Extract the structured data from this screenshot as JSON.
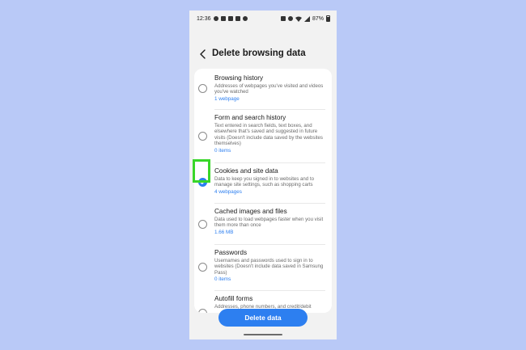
{
  "status_bar": {
    "time": "12:36",
    "battery": "87%",
    "icons_left": [
      "whatsapp-icon",
      "notification-icon",
      "gallery-icon",
      "grid-icon",
      "shazam-icon"
    ],
    "icons_right": [
      "vibrate-icon",
      "alarm-icon",
      "wifi-icon",
      "signal-icon",
      "battery-icon"
    ]
  },
  "header": {
    "title": "Delete browsing data"
  },
  "items": [
    {
      "title": "Browsing history",
      "description": "Addresses of webpages you've visited and videos you've watched",
      "count": "1 webpage",
      "checked": false
    },
    {
      "title": "Form and search history",
      "description": "Text entered in search fields, text boxes, and elsewhere that's saved and suggested in future visits (Doesn't include data saved by the websites themselves)",
      "count": "0 items",
      "checked": false
    },
    {
      "title": "Cookies and site data",
      "description": "Data to keep you signed in to websites and to manage site settings, such as shopping carts",
      "count": "4 webpages",
      "checked": true
    },
    {
      "title": "Cached images and files",
      "description": "Data used to load webpages faster when you visit them more than once",
      "count": "1.66 MB",
      "checked": false
    },
    {
      "title": "Passwords",
      "description": "Usernames and passwords used to sign in to websites (Doesn't include data saved in Samsung Pass)",
      "count": "0 items",
      "checked": false
    },
    {
      "title": "Autofill forms",
      "description": "Addresses, phone numbers, and credit/debit",
      "count": "",
      "checked": false
    }
  ],
  "footer": {
    "delete_label": "Delete data"
  },
  "colors": {
    "background": "#b9c9f7",
    "accent": "#2d7ff0",
    "highlight": "#39d629"
  }
}
